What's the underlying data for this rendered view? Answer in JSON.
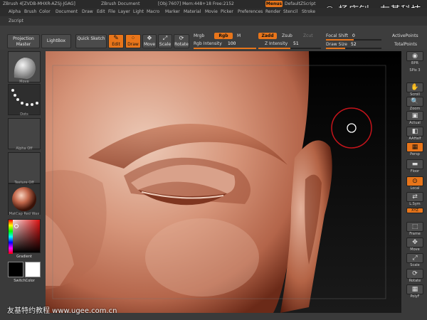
{
  "titlebar": {
    "app": "ZBrush 4[ZVDB-MHXR-AZSJ-JGAG]",
    "doc": "ZBrush Document",
    "stats": "[Obj:7607] Mem:448+18 Free:2152",
    "menus_btn": "Menus",
    "script": "DefaultZScript"
  },
  "watermark": "© 杨庆钊 · 友基科技",
  "menubar": [
    "Alpha",
    "Brush",
    "Color",
    "Document",
    "Draw",
    "Edit",
    "File",
    "Layer",
    "Light",
    "Macro",
    "Marker",
    "Material",
    "Movie",
    "Picker",
    "Preferences",
    "Render",
    "Stencil",
    "Stroke"
  ],
  "zscript_label": "Zscript",
  "toolbar": {
    "projection_master": "Projection Master",
    "lightbox": "LightBox",
    "quick_sketch": "Quick Sketch",
    "edit": "Edit",
    "draw": "Draw",
    "move": "Move",
    "scale": "Scale",
    "rotate": "Rotate",
    "mrgb": "Mrgb",
    "rgb": "Rgb",
    "m": "M",
    "rgb_intensity_label": "Rgb Intensity",
    "rgb_intensity": "100",
    "zadd": "Zadd",
    "zsub": "Zsub",
    "zcut": "Zcut",
    "z_intensity_label": "Z Intensity",
    "z_intensity": "51",
    "focal_shift_label": "Focal Shift",
    "focal_shift": "0",
    "draw_size_label": "Draw Size",
    "draw_size": "52",
    "active_points": "ActivePoints",
    "total_points": "TotalPoints"
  },
  "sliders": {
    "rgb_intensity": 1.0,
    "z_intensity": 0.51,
    "focal_shift": 0.5,
    "draw_size": 0.35
  },
  "leftpanel": {
    "brush_label": "Move",
    "stroke_label": "Dots",
    "alpha_label": "Alpha Off",
    "texture_label": "Texture Off",
    "material_label": "MatCap Red Wax",
    "gradient_label": "Gradient",
    "switch_label": "SwitchColor"
  },
  "rightpanel": [
    "BPR",
    "SPix",
    "Scroll",
    "Zoom",
    "Actual",
    "AAHalf",
    "Persp",
    "Floor",
    "Local",
    "L.Sym",
    "XYZ",
    "Frame",
    "Move",
    "Scale",
    "Rotate",
    "PolyF"
  ],
  "rightpanel_spix_value": "3",
  "footer": "友基特约教程  www.ugee.com.cn",
  "colors": {
    "accent": "#e8751a",
    "panel": "#3a3a3a",
    "skin": "#c58468"
  }
}
